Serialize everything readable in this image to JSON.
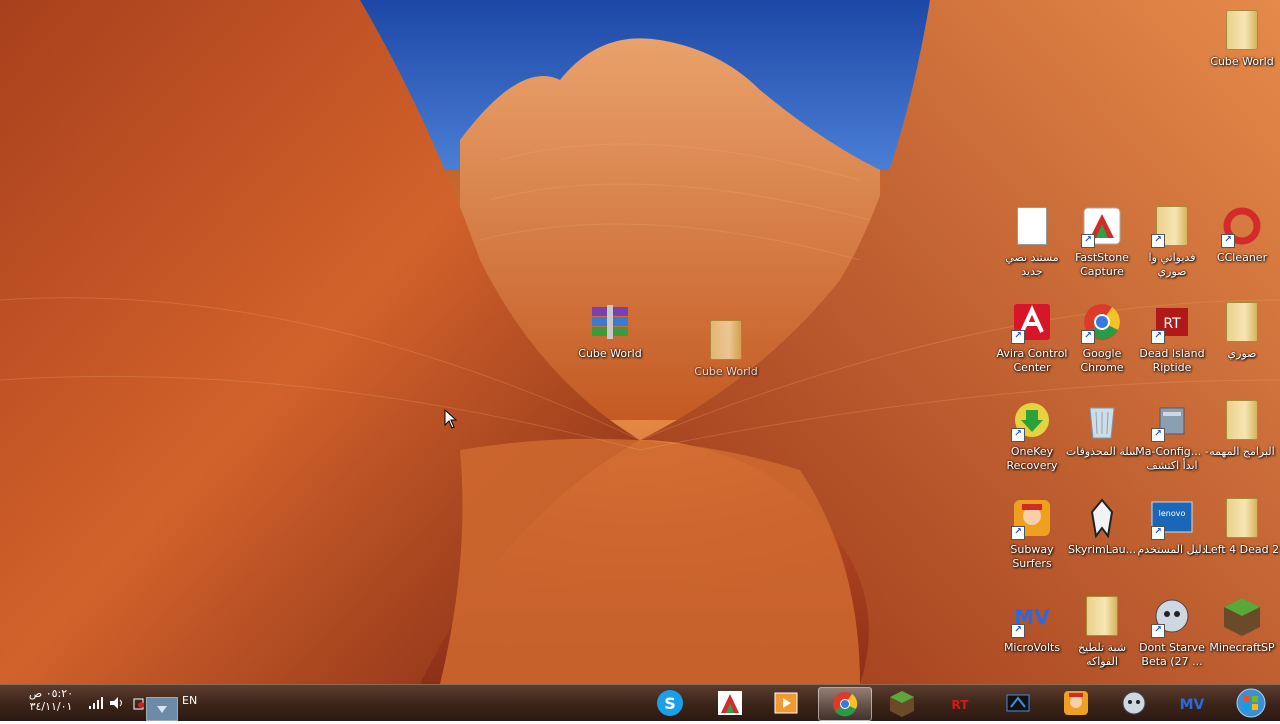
{
  "desktop": {
    "center_icons": [
      {
        "label": "Cube World"
      },
      {
        "label": "Cube World"
      }
    ],
    "icons": [
      {
        "label": "Cube World"
      },
      {
        "label": "مستند نصي جديد"
      },
      {
        "label": "FastStone Capture"
      },
      {
        "label": "فديواتي وا صوري"
      },
      {
        "label": "CCleaner"
      },
      {
        "label": "Avira Control Center"
      },
      {
        "label": "Google Chrome"
      },
      {
        "label": "Dead Island Riptide"
      },
      {
        "label": "صوري"
      },
      {
        "label": "OneKey Recovery"
      },
      {
        "label": "سلة المحذوفات"
      },
      {
        "label": "Ma-Config... - ابدأ اكتشف"
      },
      {
        "label": "البرامج المهمه"
      },
      {
        "label": "Subway Surfers"
      },
      {
        "label": "SkyrimLau..."
      },
      {
        "label": "دليل المستخدم"
      },
      {
        "label": "Left 4 Dead 2"
      },
      {
        "label": "MicroVolts"
      },
      {
        "label": "شبة تلطيخ الفواكه"
      },
      {
        "label": "Dont Starve Beta (27 ..."
      },
      {
        "label": "MinecraftSP"
      }
    ]
  },
  "taskbar": {
    "clock_time": "٠٥:٢٠ ص",
    "clock_date": "٣٤/١١/٠١",
    "language": "EN",
    "colors": {
      "start_orb": "#3a8fd6",
      "skype": "#1aa0e8"
    },
    "pinned": [
      {
        "icon": "skype-icon"
      },
      {
        "icon": "faststone-icon"
      },
      {
        "icon": "media-player-icon"
      },
      {
        "icon": "chrome-icon"
      },
      {
        "icon": "minecraft-icon"
      },
      {
        "icon": "riptide-icon"
      },
      {
        "icon": "game-icon"
      },
      {
        "icon": "subway-surfers-icon"
      },
      {
        "icon": "dont-starve-icon"
      },
      {
        "icon": "microvolts-icon"
      }
    ]
  }
}
